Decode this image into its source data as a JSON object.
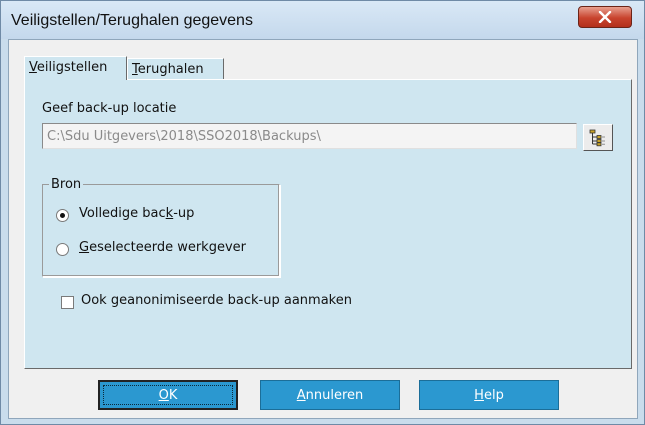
{
  "window": {
    "title": "Veiligstellen/Terughalen gegevens",
    "close_icon": "close-icon"
  },
  "tabs": [
    {
      "label": "Veiligstellen",
      "mnemonic": "V",
      "rest": "eiligstellen",
      "active": true
    },
    {
      "label": "Terughalen",
      "mnemonic": "T",
      "rest": "erughalen",
      "active": false
    }
  ],
  "backup": {
    "location_label": "Geef back-up locatie",
    "path_value": "C:\\Sdu Uitgevers\\2018\\SSO2018\\Backups\\",
    "browse_icon": "folder-tree-icon"
  },
  "source": {
    "group_label": "Bron",
    "options": [
      {
        "label_pre": "Volledige bac",
        "mnemonic": "k",
        "label_post": "-up",
        "checked": true
      },
      {
        "label_pre": "",
        "mnemonic": "G",
        "label_post": "eselecteerde werkgever",
        "checked": false
      }
    ]
  },
  "anonymize": {
    "label": "Ook geanonimiseerde back-up aanmaken",
    "checked": false
  },
  "buttons": {
    "ok": {
      "mnemonic": "O",
      "rest": "K"
    },
    "cancel": {
      "mnemonic": "A",
      "rest": "nnuleren"
    },
    "help": {
      "mnemonic": "H",
      "rest": "elp"
    }
  },
  "colors": {
    "accent_button": "#2b98d0",
    "panel": "#cfe6f0",
    "close_button": "#c8432e"
  }
}
